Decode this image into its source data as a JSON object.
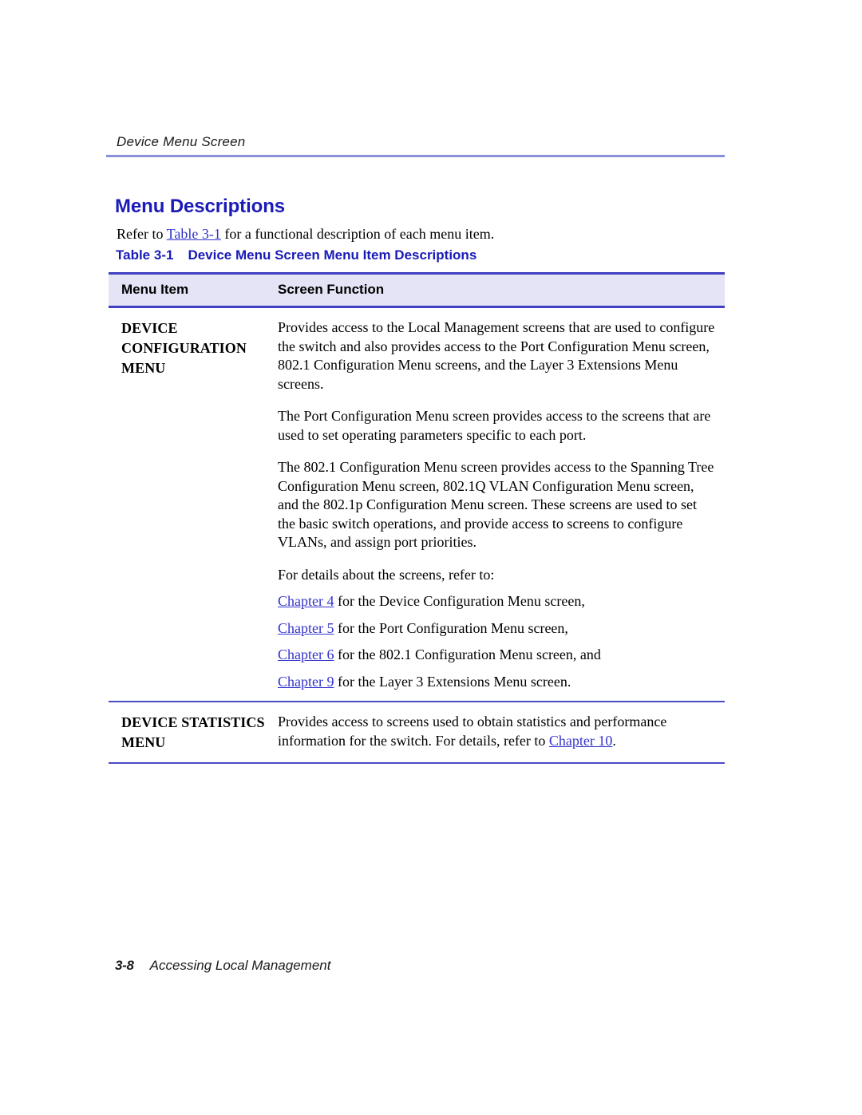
{
  "running_header": "Device Menu Screen",
  "section": {
    "heading": "Menu Descriptions",
    "intro_before": "Refer to ",
    "intro_link": "Table 3-1",
    "intro_after": " for a functional description of each menu item."
  },
  "table": {
    "caption_number": "Table 3-1",
    "caption_title": "Device Menu Screen Menu Item Descriptions",
    "columns": [
      "Menu Item",
      "Screen Function"
    ],
    "rows": [
      {
        "menu_item": "DEVICE CONFIGURATION MENU",
        "paragraphs": [
          "Provides access to the Local Management screens that are used to configure the switch and also provides access to the Port Configuration Menu screen, 802.1 Configuration Menu screens, and the Layer 3 Extensions Menu screens.",
          "The Port Configuration Menu screen provides access to the screens that are used to set operating parameters specific to each port.",
          "The 802.1 Configuration Menu screen provides access to the Spanning Tree Configuration Menu screen, 802.1Q VLAN Configuration Menu screen, and the 802.1p Configuration Menu screen. These screens are used to set the basic switch operations, and provide access to screens to configure VLANs, and assign port priorities.",
          "For details about the screens, refer to:"
        ],
        "references": [
          {
            "link": "Chapter 4",
            "text": " for the Device Configuration Menu screen,"
          },
          {
            "link": "Chapter 5",
            "text": " for the Port Configuration Menu screen,"
          },
          {
            "link": "Chapter 6",
            "text": " for the 802.1 Configuration Menu screen, and"
          },
          {
            "link": "Chapter 9",
            "text": " for the Layer 3 Extensions Menu screen."
          }
        ]
      },
      {
        "menu_item": "DEVICE STATISTICS MENU",
        "body_before": "Provides access to screens used to obtain statistics and performance information for the switch. For details, refer to ",
        "body_link": "Chapter 10",
        "body_after": "."
      }
    ]
  },
  "footer": {
    "page_number": "3-8",
    "label": "Accessing Local Management"
  },
  "colors": {
    "heading_blue": "#1a1ab8",
    "link_blue": "#3333cc",
    "rule_lavender": "#8b8fd9",
    "table_rule": "#4040c0",
    "header_row_bg": "#e4e4f6"
  }
}
